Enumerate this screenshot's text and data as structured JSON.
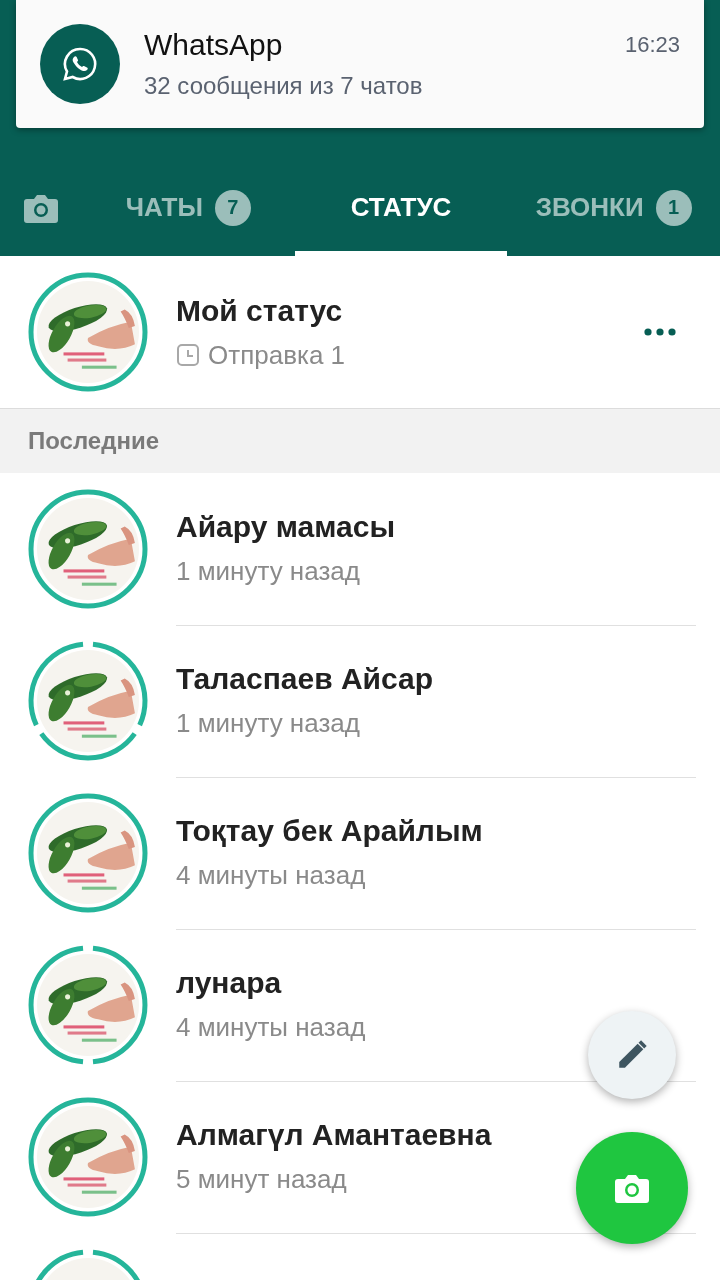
{
  "notification": {
    "app": "WhatsApp",
    "text": "32 сообщения из 7 чатов",
    "time": "16:23"
  },
  "tabs": [
    {
      "kind": "camera",
      "selected": false
    },
    {
      "kind": "text",
      "label": "ЧАТЫ",
      "badge": "7",
      "selected": false
    },
    {
      "kind": "text",
      "label": "СТАТУС",
      "selected": true
    },
    {
      "kind": "text",
      "label": "ЗВОНКИ",
      "badge": "1",
      "selected": false
    }
  ],
  "my_status": {
    "name": "Мой статус",
    "subtitle": "Отправка 1",
    "ring": [
      {
        "seen": false
      }
    ]
  },
  "section": "Последние",
  "statuses": [
    {
      "name": "Айару мамасы",
      "time": "1 минуту назад",
      "ring": [
        {
          "seen": false
        }
      ]
    },
    {
      "name": "Таласпаев Айсар",
      "time": "1 минуту назад",
      "ring": [
        {
          "seen": false
        },
        {
          "seen": false
        },
        {
          "seen": false
        }
      ]
    },
    {
      "name": "Тоқтау бек Арайлым",
      "time": "4 минуты назад",
      "ring": [
        {
          "seen": false
        }
      ]
    },
    {
      "name": "лунара",
      "time": "4 минуты назад",
      "ring": [
        {
          "seen": false
        },
        {
          "seen": false
        }
      ]
    },
    {
      "name": "Алмагүл Амантаевна",
      "time": "5 минут назад",
      "ring": [
        {
          "seen": false
        }
      ]
    },
    {
      "ring": [
        {
          "seen": false
        },
        {
          "seen": false
        }
      ]
    }
  ],
  "fabs": [
    {
      "kind": "pencil"
    },
    {
      "kind": "camera"
    }
  ]
}
